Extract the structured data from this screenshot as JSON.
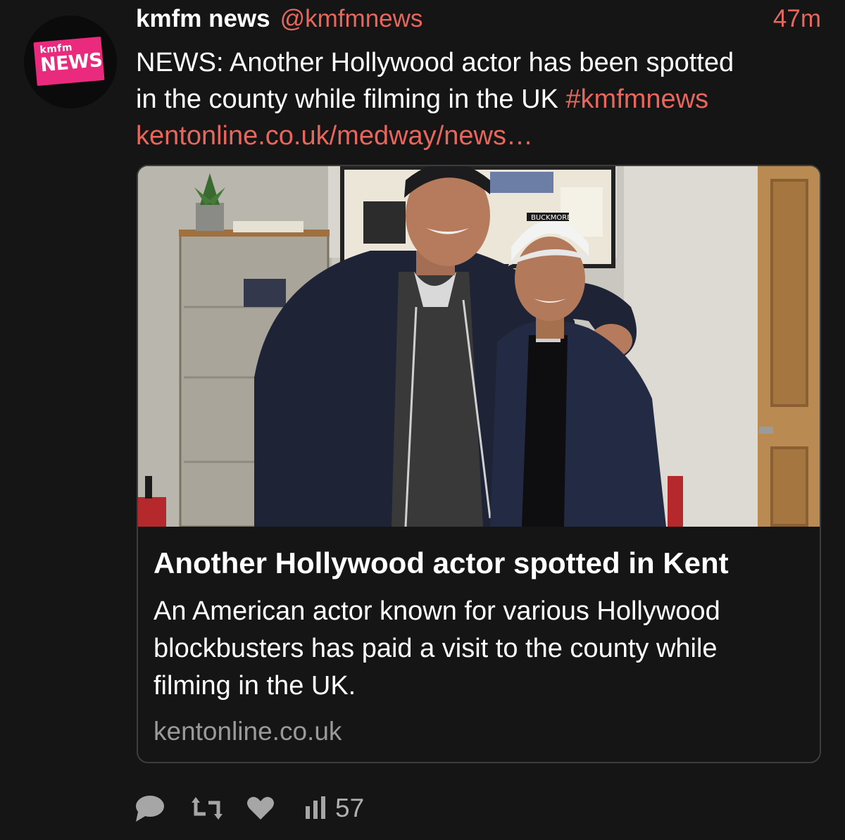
{
  "tweet": {
    "author_name": "kmfm news",
    "handle": "@kmfmnews",
    "time": "47m",
    "avatar": {
      "brand": "kmfm",
      "label": "NEWS",
      "color": "#ea2a7c"
    },
    "text_line1": "NEWS: Another Hollywood actor has been spotted",
    "text_line2": "in the county while filming in the UK",
    "hashtag": "#kmfmnews",
    "link": "kentonline.co.uk/medway/news…",
    "accent_color": "#e8665c"
  },
  "card": {
    "image_icon": "photo-two-people",
    "cap_text": "BUCKMORE",
    "title": "Another Hollywood actor spotted in Kent",
    "description": "An American actor known for various Hollywood blockbusters has paid a visit to the county while filming in the UK.",
    "domain": "kentonline.co.uk"
  },
  "actions": {
    "reply_icon": "reply-icon",
    "retweet_icon": "retweet-icon",
    "like_icon": "heart-icon",
    "views_icon": "bar-chart-icon",
    "views_count": "57"
  }
}
